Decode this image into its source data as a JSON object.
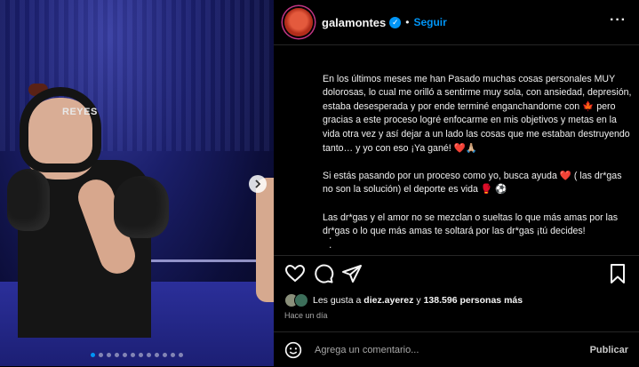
{
  "media": {
    "helmet_brand": "REYES",
    "next_icon": "chevron-right-icon",
    "carousel_dots": 12,
    "active_dot": 0
  },
  "header": {
    "username": "galamontes",
    "separator": "•",
    "follow_label": "Seguir",
    "verified_icon": "verified-badge-icon",
    "more_icon": "more-options-icon"
  },
  "caption": {
    "paragraphs": [
      "En los últimos meses me han Pasado muchas cosas personales MUY dolorosas, lo cual me orilló a sentirme muy sola, con ansiedad, depresión, estaba desesperada y por ende terminé enganchandome con 🍁 pero gracias a este proceso logré enfocarme en mis objetivos y metas en la vida otra vez y así dejar a un lado las cosas que me estaban destruyendo tanto… y yo con eso ¡Ya gané! ❤️🙏🏼",
      "Si estás pasando por un proceso como yo, busca ayuda ❤️ ( las dr*gas no son la solución) el deporte es vida 🥊 ⚽",
      "Las dr*gas y el amor no se mezclan o sueltas lo que más amas por las dr*gas o lo que más amas te soltará por las dr*gas ¡tú decides!"
    ],
    "trailing": "."
  },
  "actions": {
    "like_icon": "heart-icon",
    "comment_icon": "comment-icon",
    "share_icon": "send-icon",
    "save_icon": "bookmark-icon"
  },
  "likes": {
    "prefix": "Les gusta a",
    "user": "diez.ayerez",
    "conjunction": "y",
    "count": "138.596 personas más"
  },
  "time_ago": "Hace un día",
  "comment": {
    "placeholder": "Agrega un comentario...",
    "publish_label": "Publicar",
    "emoji_icon": "emoji-smile-icon"
  },
  "colors": {
    "accent": "#0095f6",
    "background": "#000000",
    "divider": "#262626"
  }
}
